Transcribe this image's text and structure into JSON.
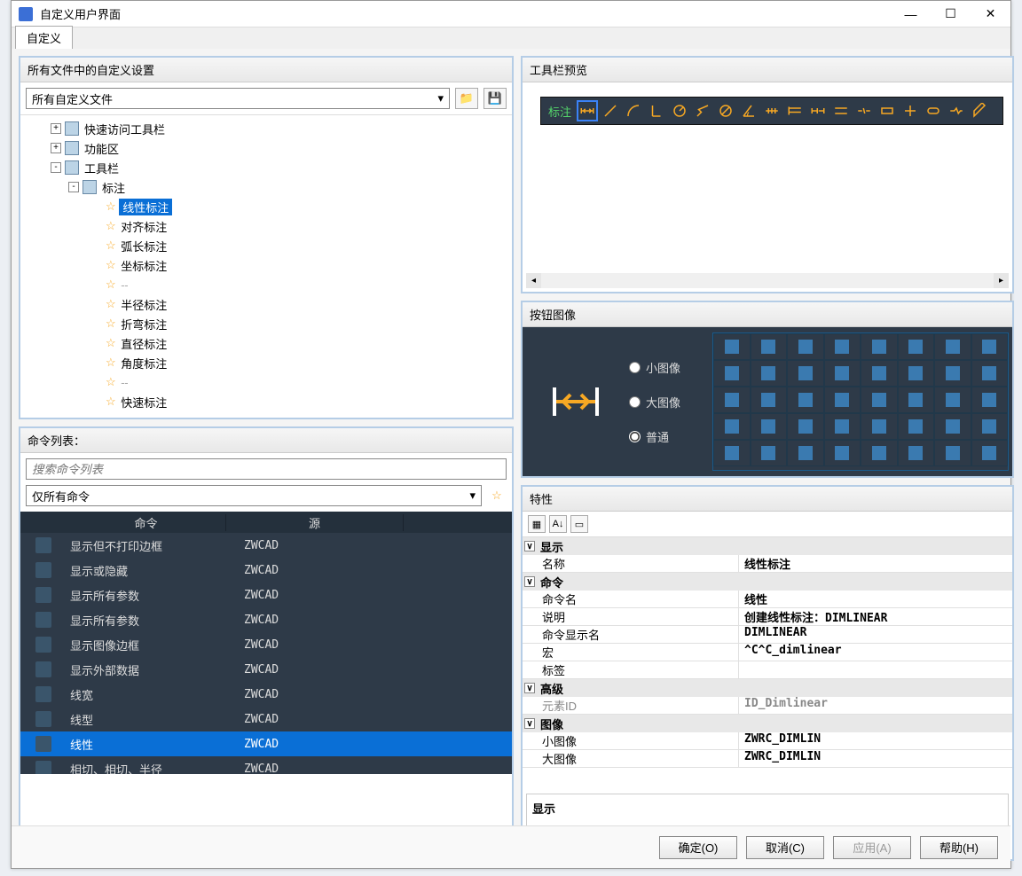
{
  "window": {
    "title": "自定义用户界面"
  },
  "tabs": {
    "main": "自定义"
  },
  "panels": {
    "customizations": {
      "header": "所有文件中的自定义设置",
      "combo": "所有自定义文件",
      "tree_top": [
        {
          "indent": 30,
          "toggle": "+",
          "icon": "qat",
          "label": "快速访问工具栏"
        },
        {
          "indent": 30,
          "toggle": "+",
          "icon": "ribbon",
          "label": "功能区"
        },
        {
          "indent": 30,
          "toggle": "-",
          "icon": "toolbar",
          "label": "工具栏"
        },
        {
          "indent": 50,
          "toggle": "-",
          "icon": "toolbar",
          "label": "标注"
        }
      ],
      "tree_items": [
        {
          "label": "线性标注",
          "selected": true
        },
        {
          "label": "对齐标注"
        },
        {
          "label": "弧长标注"
        },
        {
          "label": "坐标标注"
        },
        {
          "label": "- -",
          "dash": true
        },
        {
          "label": "半径标注"
        },
        {
          "label": "折弯标注"
        },
        {
          "label": "直径标注"
        },
        {
          "label": "角度标注"
        },
        {
          "label": "- -",
          "dash": true
        },
        {
          "label": "快速标注"
        }
      ]
    },
    "command_list": {
      "header": "命令列表：",
      "search_placeholder": "搜索命令列表",
      "filter": "仅所有命令",
      "columns": {
        "name": "命令",
        "source": "源"
      },
      "rows": [
        {
          "name": "显示但不打印边框",
          "src": "ZWCAD"
        },
        {
          "name": "显示或隐藏",
          "src": "ZWCAD"
        },
        {
          "name": "显示所有参数",
          "src": "ZWCAD"
        },
        {
          "name": "显示所有参数",
          "src": "ZWCAD"
        },
        {
          "name": "显示图像边框",
          "src": "ZWCAD"
        },
        {
          "name": "显示外部数据",
          "src": "ZWCAD"
        },
        {
          "name": "线宽",
          "src": "ZWCAD"
        },
        {
          "name": "线型",
          "src": "ZWCAD"
        },
        {
          "name": "线性",
          "src": "ZWCAD",
          "selected": true
        },
        {
          "name": "相切、相切、半径",
          "src": "ZWCAD"
        }
      ]
    },
    "toolbar_preview": {
      "header": "工具栏预览",
      "label": "标注"
    },
    "button_image": {
      "header": "按钮图像",
      "radios": {
        "small": "小图像",
        "large": "大图像",
        "normal": "普通"
      }
    },
    "properties": {
      "header": "特性",
      "groups": [
        {
          "name": "显示",
          "rows": [
            {
              "k": "名称",
              "v": "线性标注"
            }
          ]
        },
        {
          "name": "命令",
          "rows": [
            {
              "k": "命令名",
              "v": "线性"
            },
            {
              "k": "说明",
              "v": "创建线性标注：DIMLINEAR"
            },
            {
              "k": "命令显示名",
              "v": "DIMLINEAR"
            },
            {
              "k": "宏",
              "v": "^C^C_dimlinear"
            },
            {
              "k": "标签",
              "v": ""
            }
          ]
        },
        {
          "name": "高级",
          "rows": [
            {
              "k": "元素ID",
              "v": "ID_Dimlinear",
              "disabled": true
            }
          ]
        },
        {
          "name": "图像",
          "rows": [
            {
              "k": "小图像",
              "v": "ZWRC_DIMLIN"
            },
            {
              "k": "大图像",
              "v": "ZWRC_DIMLIN"
            }
          ]
        }
      ],
      "description_label": "显示"
    }
  },
  "footer": {
    "ok": "确定(O)",
    "cancel": "取消(C)",
    "apply": "应用(A)",
    "help": "帮助(H)"
  }
}
